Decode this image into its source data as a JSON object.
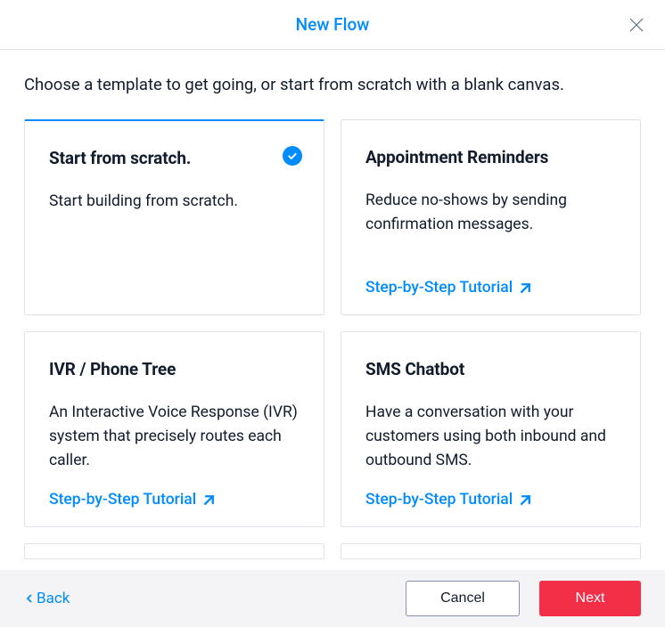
{
  "header": {
    "title": "New Flow"
  },
  "instruction": "Choose a template to get going, or start from scratch with a blank canvas.",
  "templates": [
    {
      "title": "Start from scratch.",
      "description": "Start building from scratch.",
      "selected": true,
      "tutorial": null
    },
    {
      "title": "Appointment Reminders",
      "description": "Reduce no-shows by sending confirmation messages.",
      "selected": false,
      "tutorial": "Step-by-Step Tutorial"
    },
    {
      "title": "IVR / Phone Tree",
      "description": "An Interactive Voice Response (IVR) system that precisely routes each caller.",
      "selected": false,
      "tutorial": "Step-by-Step Tutorial"
    },
    {
      "title": "SMS Chatbot",
      "description": "Have a conversation with your customers using both inbound and outbound SMS.",
      "selected": false,
      "tutorial": "Step-by-Step Tutorial"
    }
  ],
  "footer": {
    "back": "Back",
    "cancel": "Cancel",
    "next": "Next"
  }
}
